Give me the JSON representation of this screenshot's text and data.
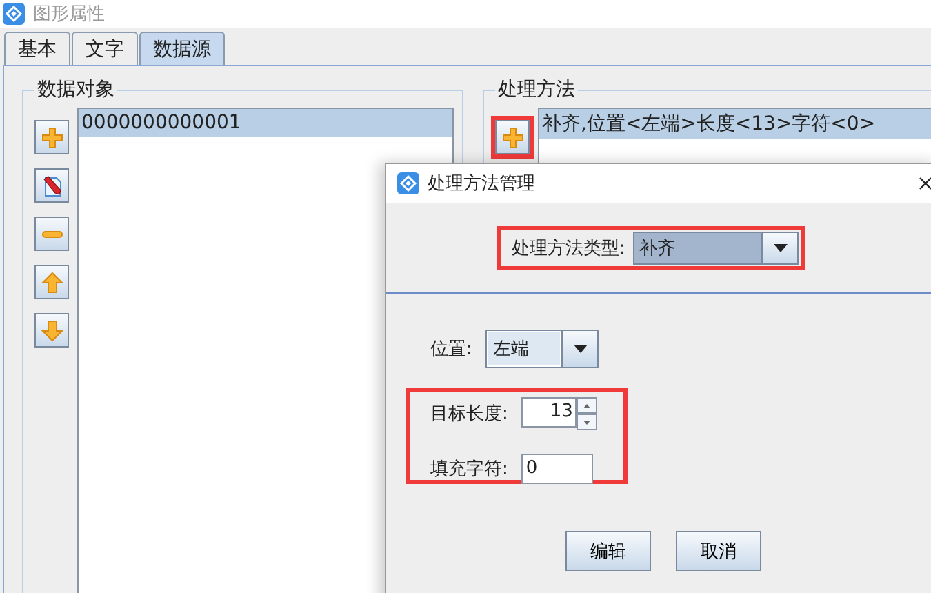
{
  "window": {
    "title": "图形属性"
  },
  "tabs": [
    {
      "label": "基本",
      "selected": false
    },
    {
      "label": "文字",
      "selected": false
    },
    {
      "label": "数据源",
      "selected": true
    }
  ],
  "data_objects": {
    "title": "数据对象",
    "tools": [
      {
        "kind": "add"
      },
      {
        "kind": "edit"
      },
      {
        "kind": "remove"
      },
      {
        "kind": "up"
      },
      {
        "kind": "down"
      }
    ],
    "items": [
      {
        "text": "0000000000001",
        "selected": true
      }
    ]
  },
  "methods": {
    "title": "处理方法",
    "tools": [
      {
        "kind": "add",
        "highlighted": true
      }
    ],
    "items": [
      {
        "text": "补齐,位置<左端>长度<13>字符<0>",
        "selected": true
      }
    ]
  },
  "dialog": {
    "title": "处理方法管理",
    "type_label": "处理方法类型:",
    "type_value": "补齐",
    "position_label": "位置:",
    "position_value": "左端",
    "length_label": "目标长度:",
    "length_value": "13",
    "fill_label": "填充字符:",
    "fill_value": "0",
    "buttons": [
      "编辑",
      "取消"
    ]
  }
}
